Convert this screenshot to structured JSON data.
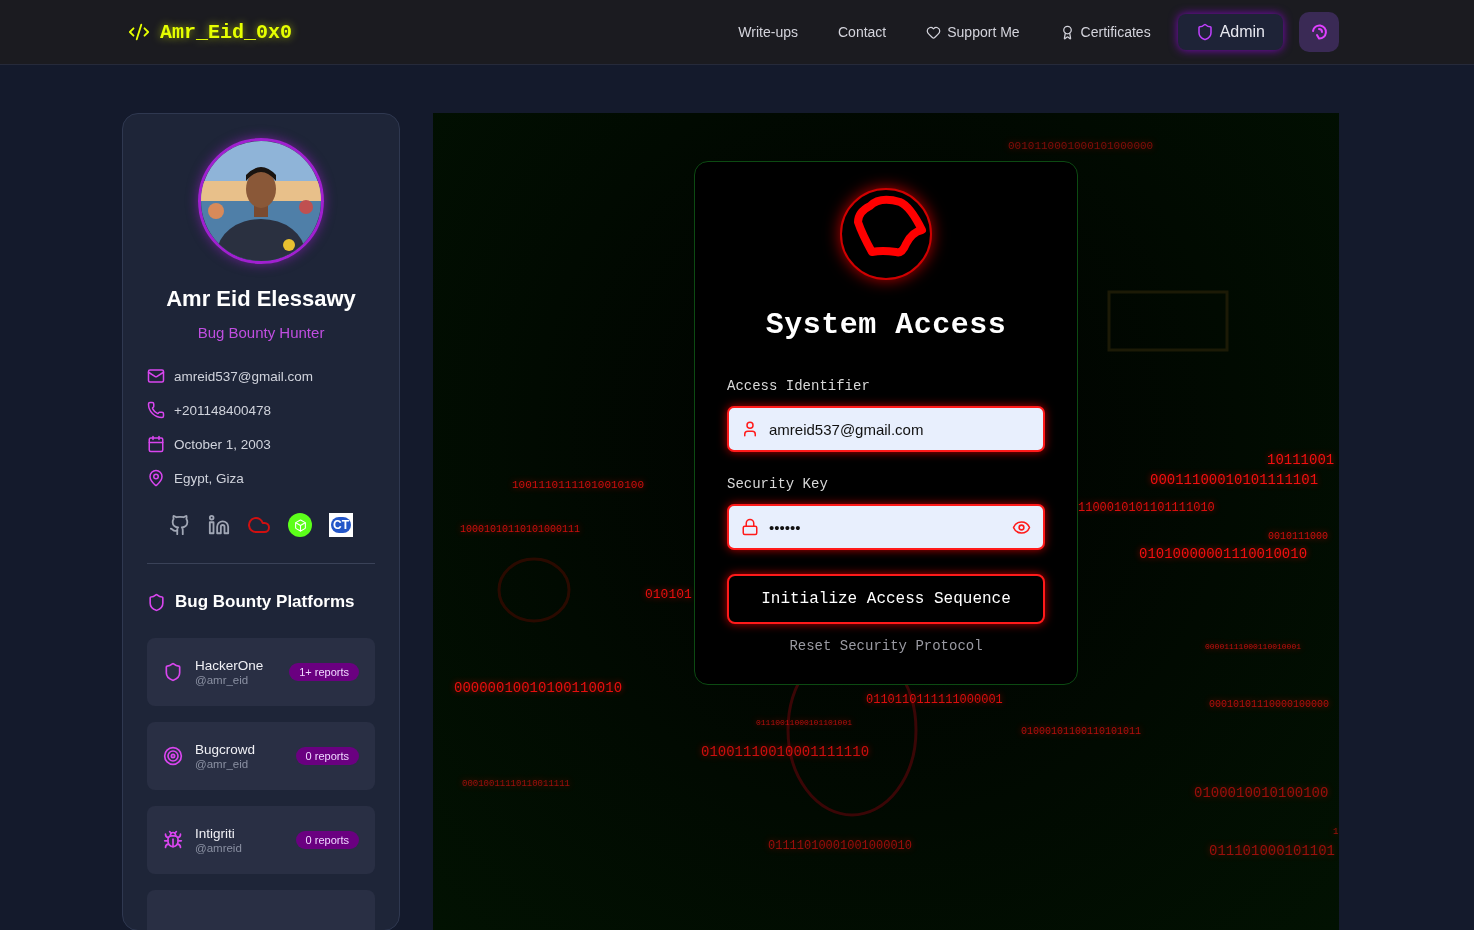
{
  "header": {
    "logo": "Amr_Eid_0x0",
    "nav": [
      {
        "label": "Write-ups",
        "kind": "plain",
        "selected": false
      },
      {
        "label": "Contact",
        "kind": "plain",
        "selected": false
      },
      {
        "label": "Support Me",
        "kind": "heart",
        "selected": false
      },
      {
        "label": "Certificates",
        "kind": "award",
        "selected": false
      },
      {
        "label": "Admin",
        "kind": "shield",
        "selected": true
      }
    ]
  },
  "profile": {
    "name": "Amr Eid Elessawy",
    "role": "Bug Bounty Hunter",
    "contacts": [
      {
        "kind": "email",
        "text": "amreid537@gmail.com"
      },
      {
        "kind": "phone",
        "text": "+201148400478"
      },
      {
        "kind": "date",
        "text": "October 1, 2003"
      },
      {
        "kind": "location",
        "text": "Egypt, Giza"
      }
    ],
    "socials": [
      {
        "kind": "github"
      },
      {
        "kind": "linkedin"
      },
      {
        "kind": "cloud"
      },
      {
        "kind": "cube"
      },
      {
        "kind": "badge",
        "text": "CT"
      }
    ],
    "platforms_title": "Bug Bounty Platforms",
    "platforms": [
      {
        "kind": "shield",
        "name": "HackerOne",
        "handle": "@amr_eid",
        "reports": "1+ reports"
      },
      {
        "kind": "target",
        "name": "Bugcrowd",
        "handle": "@amr_eid",
        "reports": "0 reports"
      },
      {
        "kind": "bug",
        "name": "Intigriti",
        "handle": "@amreid",
        "reports": "0 reports"
      }
    ],
    "platforms_overflow": true
  },
  "login": {
    "title": "System Access",
    "fields": [
      {
        "kind": "user",
        "label": "Access Identifier",
        "value": "amreid537@gmail.com"
      },
      {
        "kind": "password",
        "label": "Security Key",
        "value": "••••••"
      }
    ],
    "submit": "Initialize Access Sequence",
    "reset": "Reset Security Protocol"
  },
  "binary": [
    "0010110001000101000000",
    "10111001",
    "00011100010101111101",
    "10011101111010010100",
    "1100010101101111010",
    "10001010110101000111",
    "0010111000",
    "01010000001110010010",
    "010101",
    "00001111000110010001",
    "00000010010100110010",
    "0110110111111000001",
    "01110011000101101001",
    "00010101110000100000",
    "01000101100110101011",
    "01001110010001111110",
    "00010011110110011111",
    "0100010010100100",
    "1",
    "01111010001001000010",
    "011101000101101"
  ]
}
